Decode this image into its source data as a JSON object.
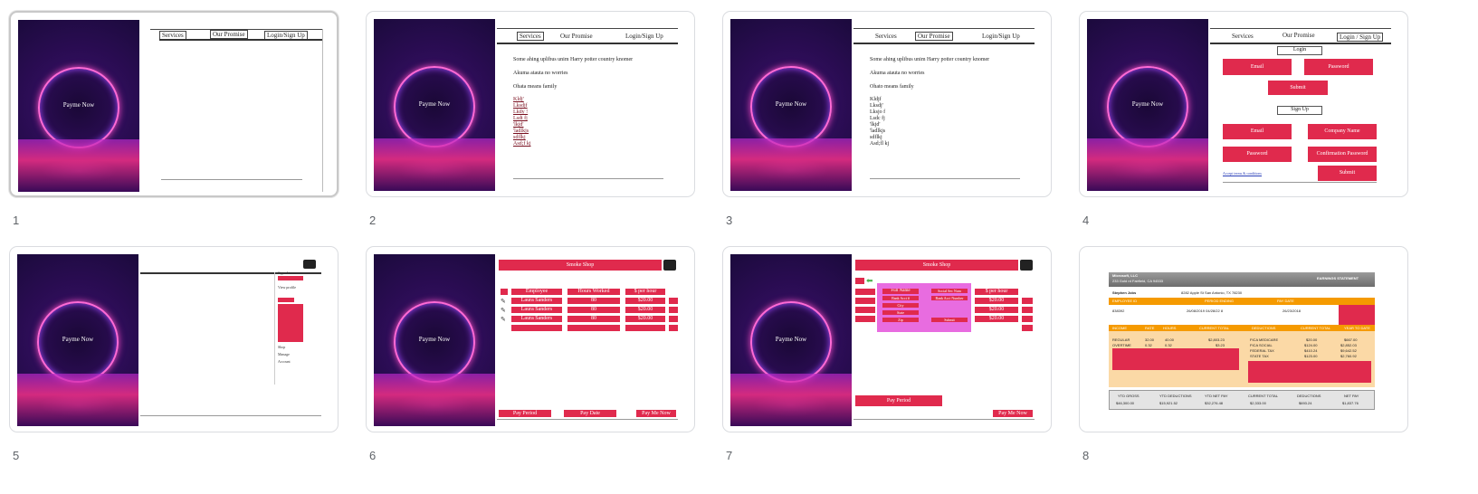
{
  "slides": [
    {
      "number": "1",
      "hero_text": "Payme Now",
      "nav": [
        "Services",
        "Our Promise",
        "Login/Sign Up"
      ]
    },
    {
      "number": "2",
      "hero_text": "Payme Now",
      "nav": [
        "Services",
        "Our Promise",
        "Login/Sign Up"
      ],
      "lines": [
        "Some ahing uplibus unim Harry potter country knomer",
        "Akuma atauta no worries",
        "Ohata means family"
      ],
      "list": [
        "Kldj'",
        "Lksdjf",
        "Lkdy !",
        "Lsdt fj",
        "'lkjd'",
        "'ladlkjs",
        "sdflkj",
        "Asd;f kj"
      ]
    },
    {
      "number": "3",
      "hero_text": "Payme Now",
      "nav": [
        "Services",
        "Our Promise",
        "Login/Sign Up"
      ],
      "lines": [
        "Some ahing uplibus unim Harry potter country knomer",
        "Akuma atauta no worries",
        "Ohato means family"
      ],
      "list": [
        "Kldjf",
        "Lksdj'",
        "Lksjo f",
        "Lsdc fj",
        "'lkjd'",
        "'ladlkjs",
        "sdflkj",
        "Asd;fl kj"
      ]
    },
    {
      "number": "4",
      "hero_text": "Payme Now",
      "nav": [
        "Services",
        "Our Promise",
        "Login / Sign Up"
      ],
      "login_label": "Login",
      "email": "Email",
      "password": "Password",
      "submit": "Submit",
      "signup_label": "Sign Up",
      "company": "Company Name",
      "confirm": "Confirmation Password",
      "terms": "Accept terms & conditions"
    },
    {
      "number": "5",
      "hero_text": "Payme Now",
      "menu": [
        "Signed in as",
        "View profile",
        "Shop",
        "Manage",
        "Account"
      ]
    },
    {
      "number": "6",
      "hero_text": "Payme Now",
      "header": "Smoke Shop",
      "columns": [
        "Employee",
        "Hours Worked",
        "$ per hour"
      ],
      "rows": [
        [
          "Laura Sanders",
          "80",
          "$20.00"
        ],
        [
          "Laura Sanders",
          "80",
          "$20.00"
        ],
        [
          "Laura Sanders",
          "80",
          "$20.00"
        ]
      ],
      "footer": [
        "Pay Period",
        "Pay Date",
        "Pay Me Now"
      ]
    },
    {
      "number": "7",
      "hero_text": "Payme Now",
      "header": "Smoke Shop",
      "popup": [
        "Full Name",
        "Bank Acct #",
        "City",
        "State",
        "Zip",
        "Social Sec Num",
        "Bank Acct Number",
        "Submit"
      ],
      "cells": [
        "$ per hour",
        "$20.00",
        "$20.00",
        "$20.00"
      ],
      "footer": [
        "Pay Period",
        "Pay Me Now"
      ]
    },
    {
      "number": "8",
      "company": "Microsoft, LLC",
      "address": "233 Gold rd Fairfield, CA 94533",
      "title": "EARNINGS STATEMENT",
      "employee": "Stephen Jobs",
      "emp_address": "8282 Apple St San Antonio, TX 78230",
      "id_head": [
        "EMPLOYEE ID",
        "PERIOD ENDING",
        "PAY DATE"
      ],
      "id_vals": [
        "838392",
        "26/08/2019 04/28/22 8",
        "26/23/2018"
      ],
      "earn_head": [
        "INCOME",
        "RATE",
        "HOURS",
        "CURRENT TOTAL",
        "DEDUCTIONS",
        "CURRENT TOTAL",
        "YEAR TO DATE"
      ],
      "earn_rows": [
        [
          "REGULAR",
          "32.00",
          "40.00",
          "$2,803.23"
        ],
        [
          "OVERTIME",
          "0.32",
          "0.32",
          "$3.23"
        ]
      ],
      "ded_rows": [
        [
          "FICA MEDICARE",
          "$20.00",
          "$667.00"
        ],
        [
          "FICA SOCIAL",
          "$124.00",
          "$2,852.03"
        ],
        [
          "FEDERAL TAX",
          "$410.24",
          "$9,642.52"
        ],
        [
          "STATE TAX",
          "$123.00",
          "$2,760.92"
        ]
      ],
      "totals_head": [
        "YTD GROSS",
        "YTD DEDUCTIONS",
        "YTD NET PAY",
        "CURRENT TOTAL",
        "DEDUCTIONS",
        "NET PAY"
      ],
      "totals_vals": [
        "$46,300.00",
        "$15,921.52",
        "$32,276.48",
        "$2,333.00",
        "$693.24",
        "$1,837.76"
      ]
    }
  ],
  "colors": {
    "accent": "#e02a4d",
    "pink": "#e86ce0",
    "orange": "#f59a00"
  }
}
